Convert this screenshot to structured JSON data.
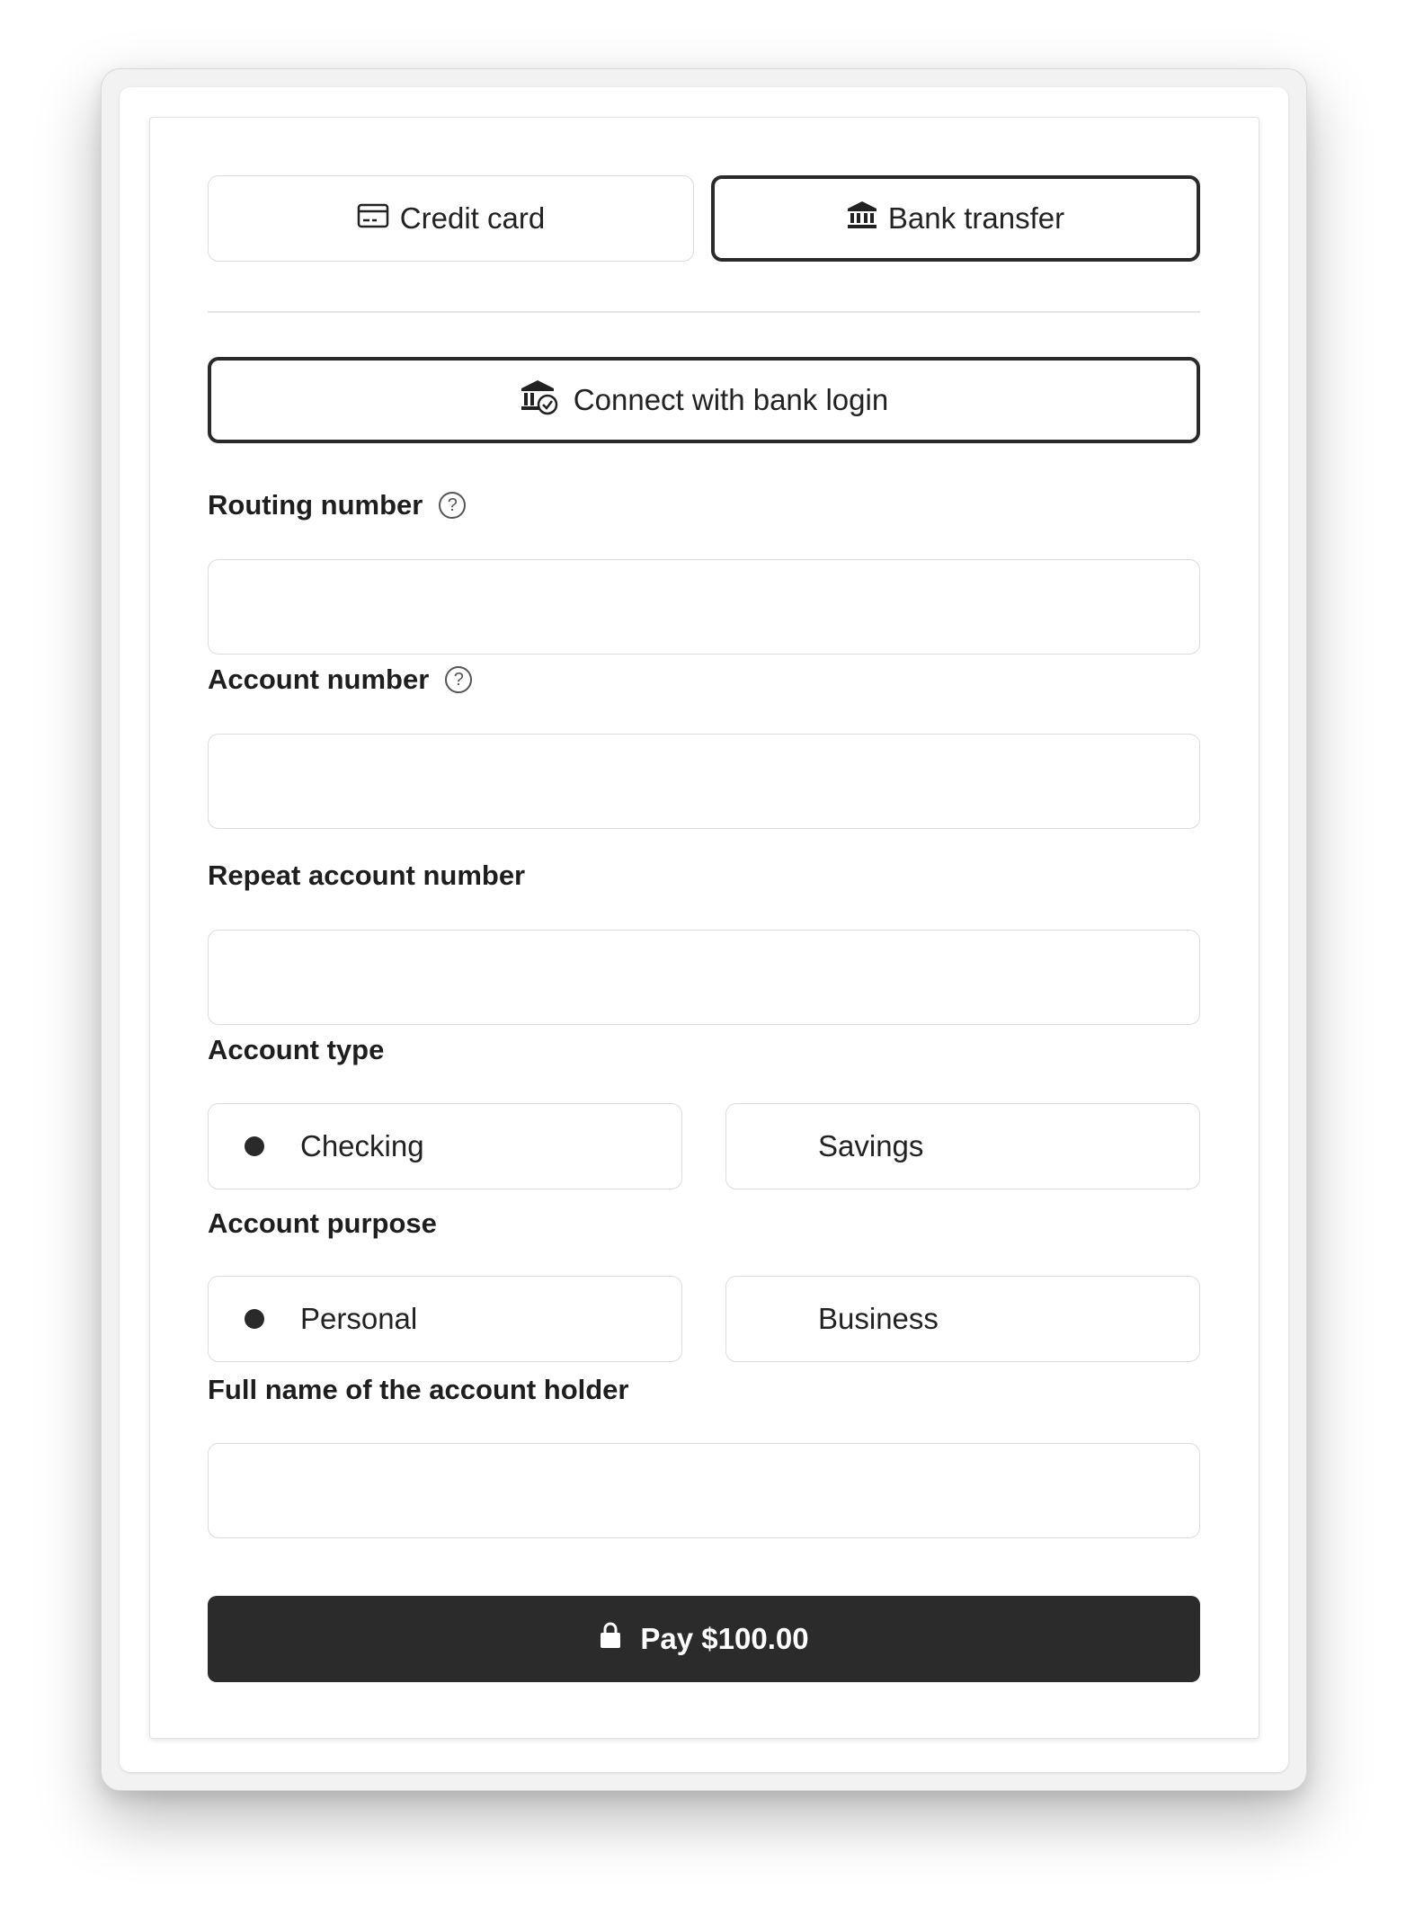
{
  "payment_tabs": [
    {
      "label": "Credit card",
      "icon": "credit-card-icon",
      "active": false
    },
    {
      "label": "Bank transfer",
      "icon": "bank-icon",
      "active": true
    }
  ],
  "connect_button": {
    "label": "Connect with bank login",
    "icon": "bank-check-icon"
  },
  "fields": {
    "routing": {
      "label": "Routing number",
      "value": ""
    },
    "account": {
      "label": "Account number",
      "value": ""
    },
    "repeat_account": {
      "label": "Repeat account number",
      "value": ""
    },
    "holder_name": {
      "label": "Full name of the account holder",
      "value": ""
    }
  },
  "account_type": {
    "label": "Account type",
    "options": [
      {
        "label": "Checking",
        "selected": true
      },
      {
        "label": "Savings",
        "selected": false
      }
    ]
  },
  "account_purpose": {
    "label": "Account purpose",
    "options": [
      {
        "label": "Personal",
        "selected": true
      },
      {
        "label": "Business",
        "selected": false
      }
    ]
  },
  "pay_button": {
    "label": "Pay $100.00",
    "icon": "lock-icon"
  },
  "colors": {
    "primary": "#2b2b2b",
    "border": "#dcdcdc"
  }
}
